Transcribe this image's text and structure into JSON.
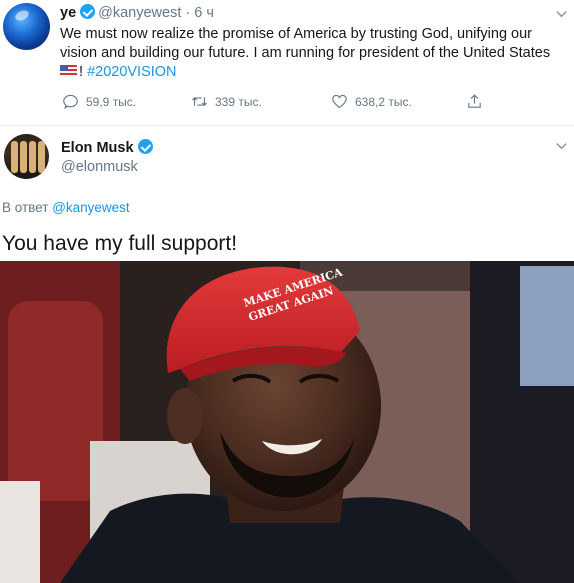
{
  "tweet1": {
    "name": "ye",
    "handle": "@kanyewest",
    "separator": "·",
    "time": "6 ч",
    "text": "We must now realize the promise of America by trusting God, unifying our vision and building our future. I am running for president of the United States",
    "suffix": "!",
    "hashtag": "#2020VISION",
    "replies": "59,9 тыс.",
    "retweets": "339 тыс.",
    "likes": "638,2 тыс."
  },
  "tweet2": {
    "name": "Elon Musk",
    "handle": "@elonmusk",
    "reply_prefix": "В ответ",
    "reply_to": "@kanyewest",
    "text": "You have my full support!"
  },
  "photo": {
    "hat_text_line1": "MAKE AMERICA",
    "hat_text_line2": "GREAT AGAIN"
  },
  "icons": {
    "verified": "verified-badge-icon",
    "reply": "reply-icon",
    "retweet": "retweet-icon",
    "like": "heart-icon",
    "share": "share-icon",
    "menu": "chevron-down-icon"
  },
  "colors": {
    "link": "#1b95e0",
    "verified": "#1da1f2",
    "muted": "#657786"
  }
}
